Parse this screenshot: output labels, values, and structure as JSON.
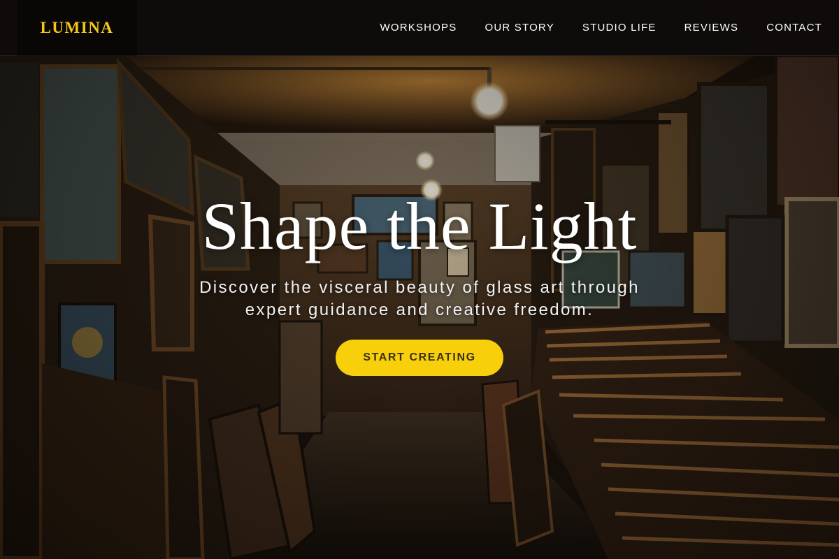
{
  "brand": {
    "name": "LUMINA",
    "accent_color": "#f5c518"
  },
  "nav": {
    "items": [
      {
        "label": "WORKSHOPS"
      },
      {
        "label": "OUR STORY"
      },
      {
        "label": "STUDIO LIFE"
      },
      {
        "label": "REVIEWS"
      },
      {
        "label": "CONTACT"
      }
    ]
  },
  "hero": {
    "title": "Shape the Light",
    "subtitle": "Discover the visceral beauty of glass art through expert guidance and creative freedom.",
    "cta_label": "START CREATING",
    "cta_color": "#f7cf0b",
    "background_icon": "gallery-corridor-photo"
  }
}
